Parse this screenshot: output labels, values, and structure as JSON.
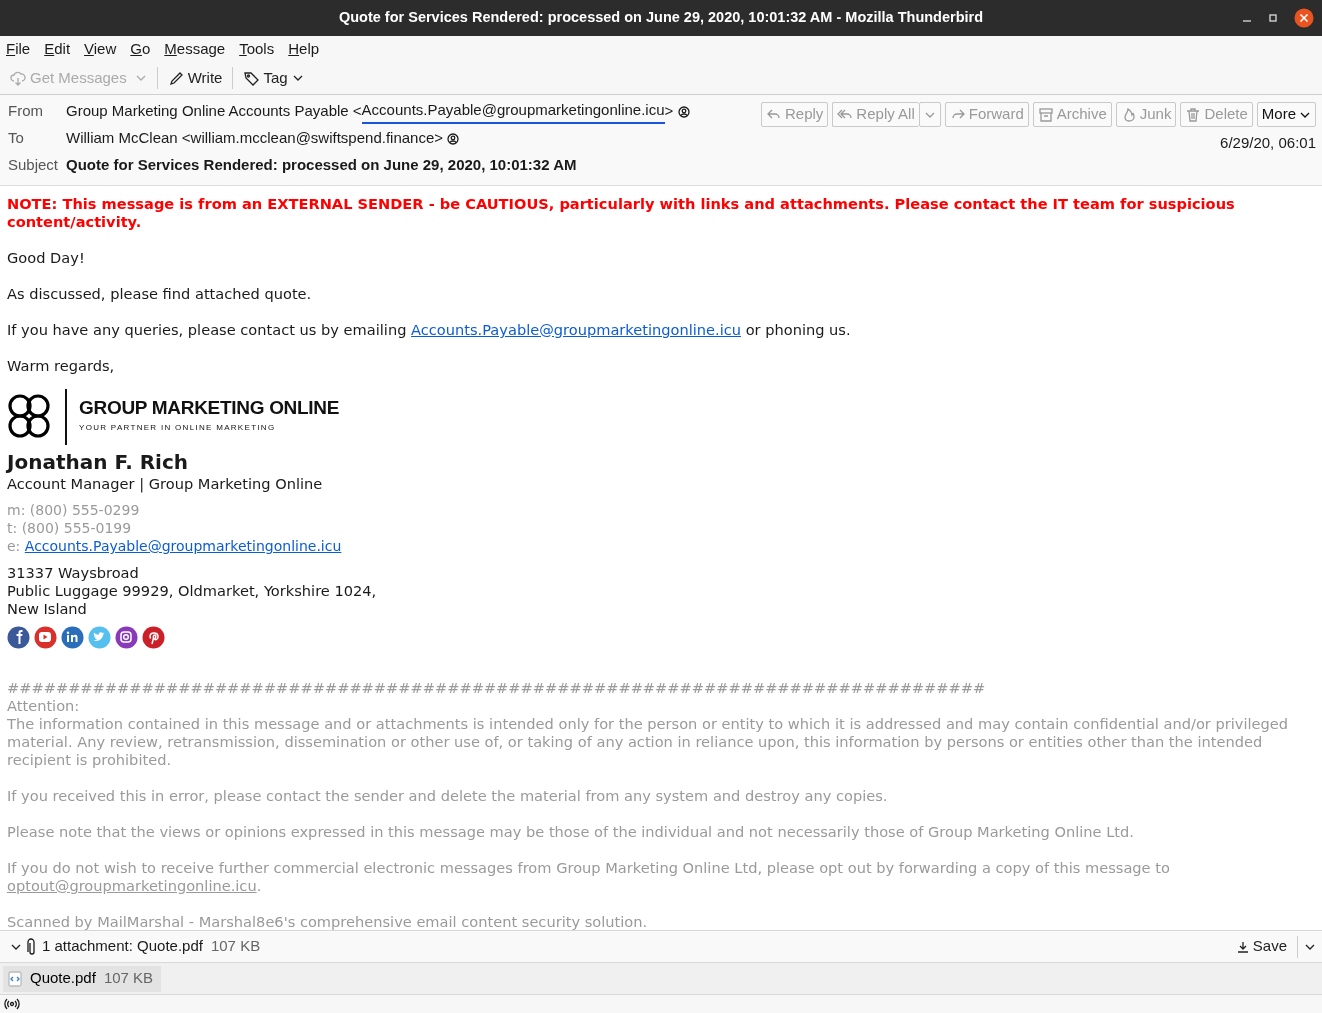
{
  "window": {
    "title": "Quote for Services Rendered: processed on June 29, 2020, 10:01:32 AM - Mozilla Thunderbird"
  },
  "menu": [
    "File",
    "Edit",
    "View",
    "Go",
    "Message",
    "Tools",
    "Help"
  ],
  "toolbar": [
    {
      "kind": "get",
      "label": "Get Messages",
      "disabled": true,
      "dropdown": true
    },
    {
      "kind": "write",
      "label": "Write",
      "disabled": false,
      "dropdown": false
    },
    {
      "kind": "tag",
      "label": "Tag",
      "disabled": false,
      "dropdown": true
    }
  ],
  "header": {
    "from": {
      "label": "From",
      "name": "Group Marketing Online Accounts Payable <",
      "email": "Accounts.Payable@groupmarketingonline.icu",
      "suffix": ">"
    },
    "to": {
      "label": "To",
      "value": "William McClean <william.mcclean@swiftspend.finance>"
    },
    "subject": {
      "label": "Subject",
      "value": "Quote for Services Rendered: processed on June 29, 2020, 10:01:32 AM"
    },
    "date": "6/29/20, 06:01",
    "actions": [
      {
        "kind": "reply",
        "label": "Reply",
        "disabled": true,
        "dropdown": false
      },
      {
        "kind": "replyall",
        "label": "Reply All",
        "disabled": true,
        "dropdown": true
      },
      {
        "kind": "forward",
        "label": "Forward",
        "disabled": true,
        "dropdown": false
      },
      {
        "kind": "archive",
        "label": "Archive",
        "disabled": true,
        "dropdown": false
      },
      {
        "kind": "junk",
        "label": "Junk",
        "disabled": true,
        "dropdown": false
      },
      {
        "kind": "delete",
        "label": "Delete",
        "disabled": true,
        "dropdown": false
      },
      {
        "kind": "more",
        "label": "More",
        "disabled": false,
        "dropdown": true
      }
    ]
  },
  "body": [
    {
      "kind": "warning",
      "text": "NOTE: This message is from an EXTERNAL SENDER - be CAUTIOUS, particularly with links and attachments. Please contact the IT team for suspicious content/activity."
    },
    {
      "kind": "text",
      "text": "Good Day!"
    },
    {
      "kind": "text",
      "text": "As discussed, please find attached quote."
    },
    {
      "kind": "link",
      "before": "If you have any queries, please contact us by emailing ",
      "link": "Accounts.Payable@groupmarketingonline.icu",
      "after": " or phoning us."
    },
    {
      "kind": "text",
      "text": "Warm regards,"
    }
  ],
  "signature": {
    "logo_title": "GROUP MARKETING ONLINE",
    "logo_tagline": "YOUR PARTNER IN ONLINE MARKETING",
    "name": "Jonathan F. Rich",
    "role": "Account Manager | Group Marketing Online",
    "phones": [
      "m: (800) 555-0299",
      "t: (800) 555-0199"
    ],
    "email_prefix": "e: ",
    "email": "Accounts.Payable@groupmarketingonline.icu",
    "address": [
      "31337 Waysbroad",
      "Public Luggage 99929, Oldmarket, Yorkshire 1024,",
      "New Island"
    ],
    "social": [
      {
        "kind": "facebook",
        "color": "#3b5998"
      },
      {
        "kind": "youtube",
        "color": "#d8302b"
      },
      {
        "kind": "linkedin",
        "color": "#2a6ebb"
      },
      {
        "kind": "twitter",
        "color": "#55c0ef"
      },
      {
        "kind": "instagram",
        "color": "#8a3ab9"
      },
      {
        "kind": "pinterest",
        "color": "#cb2027"
      }
    ]
  },
  "disclaimer": {
    "rule": "################################################################################",
    "heading": "Attention:",
    "paragraphs": [
      {
        "kind": "text",
        "text": "The information contained in this message and or attachments is intended only for the person or entity to which it is addressed and may contain confidential and/or privileged material. Any review, retransmission, dissemination or other use of, or taking of any action in reliance upon, this information by persons or entities other than the intended recipient is prohibited."
      },
      {
        "kind": "text",
        "text": "If you received this in error, please contact the sender and delete the material from any system and destroy any copies."
      },
      {
        "kind": "text",
        "text": "Please note that the views or opinions expressed in this message may be those of the individual and not necessarily those of Group Marketing Online Ltd."
      },
      {
        "kind": "link",
        "before": "If you do not wish to receive further commercial electronic messages from Group Marketing Online Ltd, please opt out by forwarding a copy of this message to ",
        "link": "optout@groupmarketingonline.icu",
        "after": "."
      },
      {
        "kind": "text",
        "text": "Scanned by MailMarshal - Marshal8e6's comprehensive email content security solution."
      }
    ]
  },
  "attachments": {
    "expanded": true,
    "summary": "1 attachment: Quote.pdf",
    "size": "107 KB",
    "save": "Save",
    "items": [
      {
        "name": "Quote.pdf",
        "size": "107 KB"
      }
    ]
  }
}
